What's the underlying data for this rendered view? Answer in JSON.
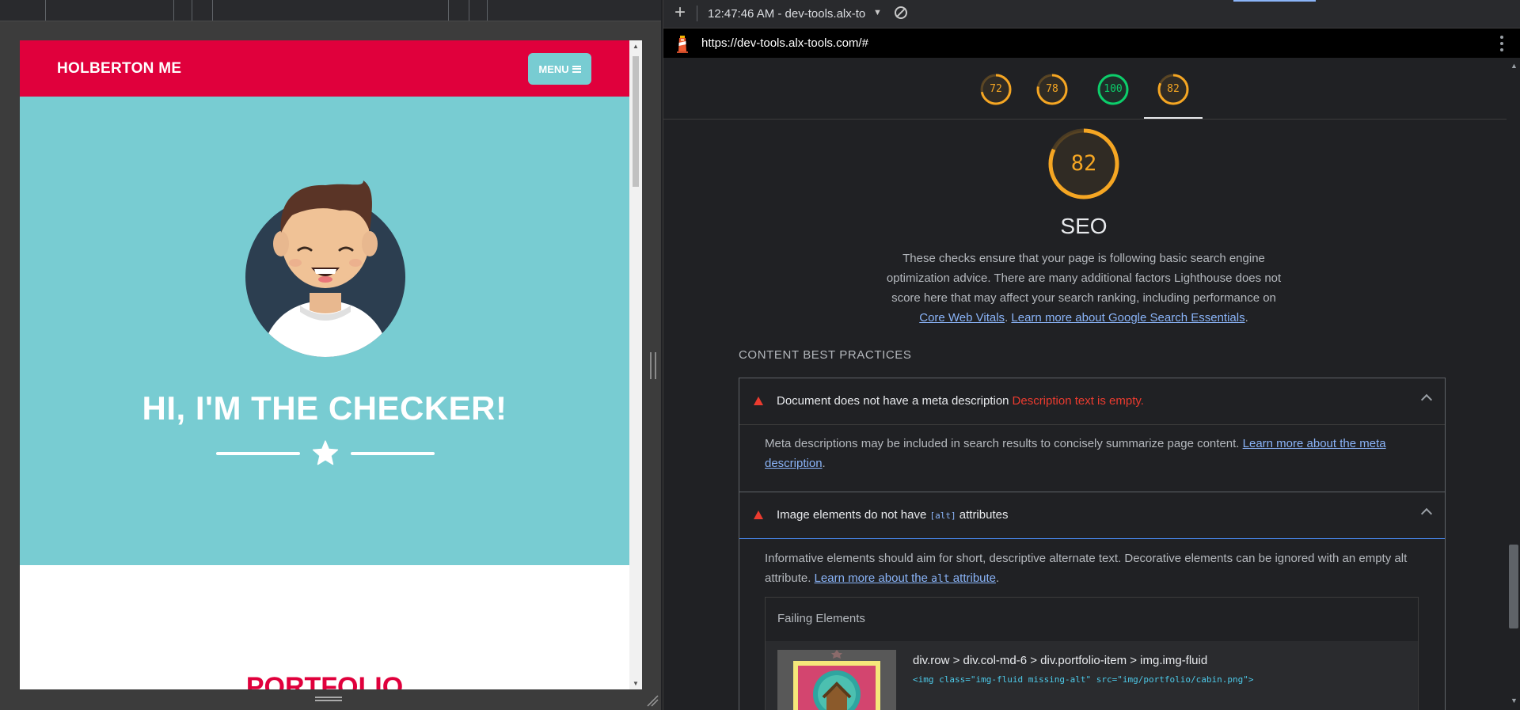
{
  "device_preview": {
    "brand": "HOLBERTON ME",
    "menu_label": "MENU",
    "hero_title": "HI, I'M THE CHECKER!",
    "portfolio_title": "PORTFOLIO"
  },
  "devtools": {
    "toolbar": {
      "report_selector": "12:47:46 AM - dev-tools.alx-to"
    },
    "url": "https://dev-tools.alx-tools.com/#",
    "gauges": [
      {
        "score": "72",
        "color": "#f5a623"
      },
      {
        "score": "78",
        "color": "#f5a623"
      },
      {
        "score": "100",
        "color": "#0cce6b"
      },
      {
        "score": "82",
        "color": "#f5a623"
      }
    ],
    "category": {
      "score": "82",
      "title": "SEO",
      "description_part1": "These checks ensure that your page is following basic search engine optimization advice. There are many additional factors Lighthouse does not score here that may affect your search ranking, including performance on ",
      "link_core_web_vitals": "Core Web Vitals",
      "link_search_essentials": "Learn more about Google Search Essentials",
      "group_title": "CONTENT BEST PRACTICES"
    },
    "audits": {
      "meta": {
        "title": "Document does not have a meta description",
        "display_value": "Description text is empty.",
        "description": "Meta descriptions may be included in search results to concisely summarize page content. ",
        "link": "Learn more about the meta description"
      },
      "alt": {
        "title_before": "Image elements do not have ",
        "title_code": "[alt]",
        "title_after": " attributes",
        "description": "Informative elements should aim for short, descriptive alternate text. Decorative elements can be ignored with an empty alt attribute. ",
        "link_before": "Learn more about the ",
        "link_code": "alt",
        "link_after": " attribute",
        "failing_header": "Failing Elements",
        "node_path": "div.row > div.col-md-6 > div.portfolio-item > img.img-fluid",
        "node_snippet": "<img class=\"img-fluid missing-alt\" src=\"img/portfolio/cabin.png\">"
      }
    },
    "colors": {
      "average": "#f5a623",
      "pass": "#0cce6b",
      "fail": "#eb3b2f",
      "link": "#8ab4f8"
    }
  }
}
